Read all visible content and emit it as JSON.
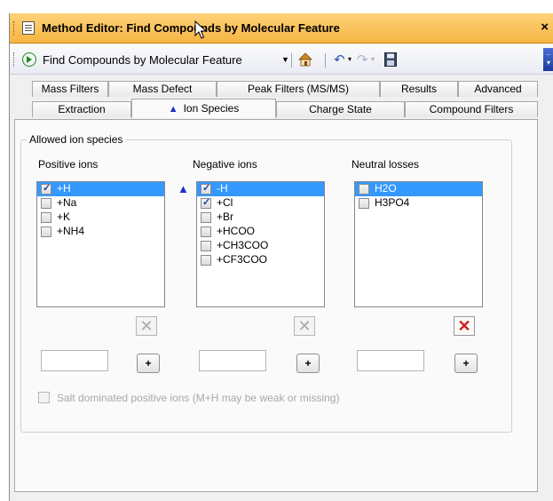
{
  "window": {
    "title": "Method Editor: Find Compounds by Molecular Feature",
    "close_glyph": "×"
  },
  "toolbar": {
    "method_name": "Find Compounds by Molecular Feature",
    "dropdown_glyph": "▼",
    "undo_glyph": "↶",
    "redo_glyph": "↷",
    "small_dd_glyph": "▾"
  },
  "tabs": {
    "row1": [
      "Mass Filters",
      "Mass Defect",
      "Peak Filters (MS/MS)",
      "Results",
      "Advanced"
    ],
    "row2": [
      "Extraction",
      "Ion Species",
      "Charge State",
      "Compound Filters"
    ],
    "active": "Ion Species"
  },
  "group": {
    "legend": "Allowed ion species"
  },
  "positive": {
    "label": "Positive ions",
    "items": [
      {
        "text": "+H",
        "checked": true,
        "selected": true
      },
      {
        "text": "+Na",
        "checked": false,
        "selected": false
      },
      {
        "text": "+K",
        "checked": false,
        "selected": false
      },
      {
        "text": "+NH4",
        "checked": false,
        "selected": false
      }
    ]
  },
  "negative": {
    "label": "Negative ions",
    "items": [
      {
        "text": "-H",
        "checked": true,
        "selected": true
      },
      {
        "text": "+Cl",
        "checked": true,
        "selected": false
      },
      {
        "text": "+Br",
        "checked": false,
        "selected": false
      },
      {
        "text": "+HCOO",
        "checked": false,
        "selected": false
      },
      {
        "text": "+CH3COO",
        "checked": false,
        "selected": false
      },
      {
        "text": "+CF3COO",
        "checked": false,
        "selected": false
      }
    ]
  },
  "neutral": {
    "label": "Neutral losses",
    "items": [
      {
        "text": "H2O",
        "checked": false,
        "selected": true
      },
      {
        "text": "H3PO4",
        "checked": false,
        "selected": false
      }
    ]
  },
  "buttons": {
    "delete_glyph": "✕",
    "add_glyph": "+"
  },
  "salt": {
    "label": "Salt dominated positive ions (M+H may be weak or missing)",
    "checked": false,
    "enabled": false
  },
  "warning_glyph": "▲",
  "colors": {
    "title_bar": "#f5b542",
    "selection": "#3399ff",
    "marker_blue": "#1a2ecc",
    "delete_red": "#d11c1c"
  }
}
